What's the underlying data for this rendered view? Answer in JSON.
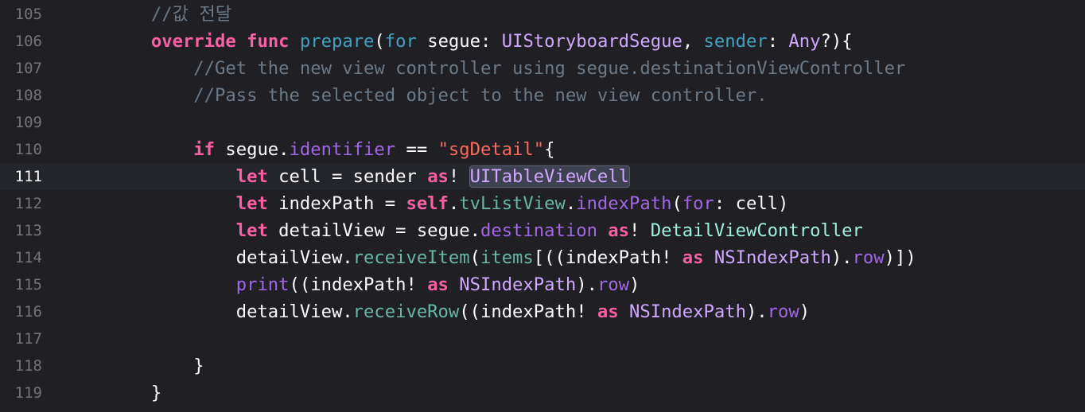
{
  "editor": {
    "current_line": "111",
    "colors": {
      "background": "#1f1f24",
      "current_line_background": "#23252b",
      "line_number": "#747478",
      "keyword": "#fc5fa3",
      "comment": "#6c7986",
      "string": "#fc6a5d",
      "type": "#d0a8ff",
      "project_type": "#9ef1dd",
      "declaration": "#41a1c0",
      "member": "#a167e6",
      "project_member": "#67b7a4",
      "plain": "#ffffff"
    },
    "lines": [
      {
        "number": "105",
        "tokens": [
          {
            "t": "        "
          },
          {
            "t": "//값 전달",
            "c": "comment"
          }
        ]
      },
      {
        "number": "106",
        "tokens": [
          {
            "t": "        "
          },
          {
            "t": "override",
            "c": "keyword"
          },
          {
            "t": " "
          },
          {
            "t": "func",
            "c": "keyword"
          },
          {
            "t": " "
          },
          {
            "t": "prepare",
            "c": "decl"
          },
          {
            "t": "("
          },
          {
            "t": "for",
            "c": "decl"
          },
          {
            "t": " segue: "
          },
          {
            "t": "UIStoryboardSegue",
            "c": "type"
          },
          {
            "t": ", "
          },
          {
            "t": "sender",
            "c": "decl"
          },
          {
            "t": ": "
          },
          {
            "t": "Any",
            "c": "type"
          },
          {
            "t": "?){"
          }
        ]
      },
      {
        "number": "107",
        "tokens": [
          {
            "t": "            "
          },
          {
            "t": "//Get the new view controller using segue.destinationViewController",
            "c": "comment"
          }
        ]
      },
      {
        "number": "108",
        "tokens": [
          {
            "t": "            "
          },
          {
            "t": "//Pass the selected object to the new view controller.",
            "c": "comment"
          }
        ]
      },
      {
        "number": "109",
        "tokens": []
      },
      {
        "number": "110",
        "tokens": [
          {
            "t": "            "
          },
          {
            "t": "if",
            "c": "keyword"
          },
          {
            "t": " segue."
          },
          {
            "t": "identifier",
            "c": "member"
          },
          {
            "t": " == "
          },
          {
            "t": "\"sgDetail\"",
            "c": "string"
          },
          {
            "t": "{"
          }
        ]
      },
      {
        "number": "111",
        "tokens": [
          {
            "t": "                "
          },
          {
            "t": "let",
            "c": "keyword"
          },
          {
            "t": " cell = sender "
          },
          {
            "t": "as",
            "c": "keyword"
          },
          {
            "t": "! "
          },
          {
            "t": "UITableViewCell",
            "c": "highlight"
          }
        ]
      },
      {
        "number": "112",
        "tokens": [
          {
            "t": "                "
          },
          {
            "t": "let",
            "c": "keyword"
          },
          {
            "t": " indexPath = "
          },
          {
            "t": "self",
            "c": "keyword"
          },
          {
            "t": "."
          },
          {
            "t": "tvListView",
            "c": "project-member"
          },
          {
            "t": "."
          },
          {
            "t": "indexPath",
            "c": "member"
          },
          {
            "t": "("
          },
          {
            "t": "for",
            "c": "member"
          },
          {
            "t": ": cell)"
          }
        ]
      },
      {
        "number": "113",
        "tokens": [
          {
            "t": "                "
          },
          {
            "t": "let",
            "c": "keyword"
          },
          {
            "t": " detailView = segue."
          },
          {
            "t": "destination",
            "c": "member"
          },
          {
            "t": " "
          },
          {
            "t": "as",
            "c": "keyword"
          },
          {
            "t": "! "
          },
          {
            "t": "DetailViewController",
            "c": "project-type"
          }
        ]
      },
      {
        "number": "114",
        "tokens": [
          {
            "t": "                detailView."
          },
          {
            "t": "receiveItem",
            "c": "project-member"
          },
          {
            "t": "("
          },
          {
            "t": "items",
            "c": "project-member"
          },
          {
            "t": "[((indexPath! "
          },
          {
            "t": "as",
            "c": "keyword"
          },
          {
            "t": " "
          },
          {
            "t": "NSIndexPath",
            "c": "type"
          },
          {
            "t": ")."
          },
          {
            "t": "row",
            "c": "member"
          },
          {
            "t": ")])"
          }
        ]
      },
      {
        "number": "115",
        "tokens": [
          {
            "t": "                "
          },
          {
            "t": "print",
            "c": "member"
          },
          {
            "t": "((indexPath! "
          },
          {
            "t": "as",
            "c": "keyword"
          },
          {
            "t": " "
          },
          {
            "t": "NSIndexPath",
            "c": "type"
          },
          {
            "t": ")."
          },
          {
            "t": "row",
            "c": "member"
          },
          {
            "t": ")"
          }
        ]
      },
      {
        "number": "116",
        "tokens": [
          {
            "t": "                detailView."
          },
          {
            "t": "receiveRow",
            "c": "project-member"
          },
          {
            "t": "((indexPath! "
          },
          {
            "t": "as",
            "c": "keyword"
          },
          {
            "t": " "
          },
          {
            "t": "NSIndexPath",
            "c": "type"
          },
          {
            "t": ")."
          },
          {
            "t": "row",
            "c": "member"
          },
          {
            "t": ")"
          }
        ]
      },
      {
        "number": "117",
        "tokens": []
      },
      {
        "number": "118",
        "tokens": [
          {
            "t": "            }"
          }
        ]
      },
      {
        "number": "119",
        "tokens": [
          {
            "t": "        }"
          }
        ]
      }
    ]
  }
}
